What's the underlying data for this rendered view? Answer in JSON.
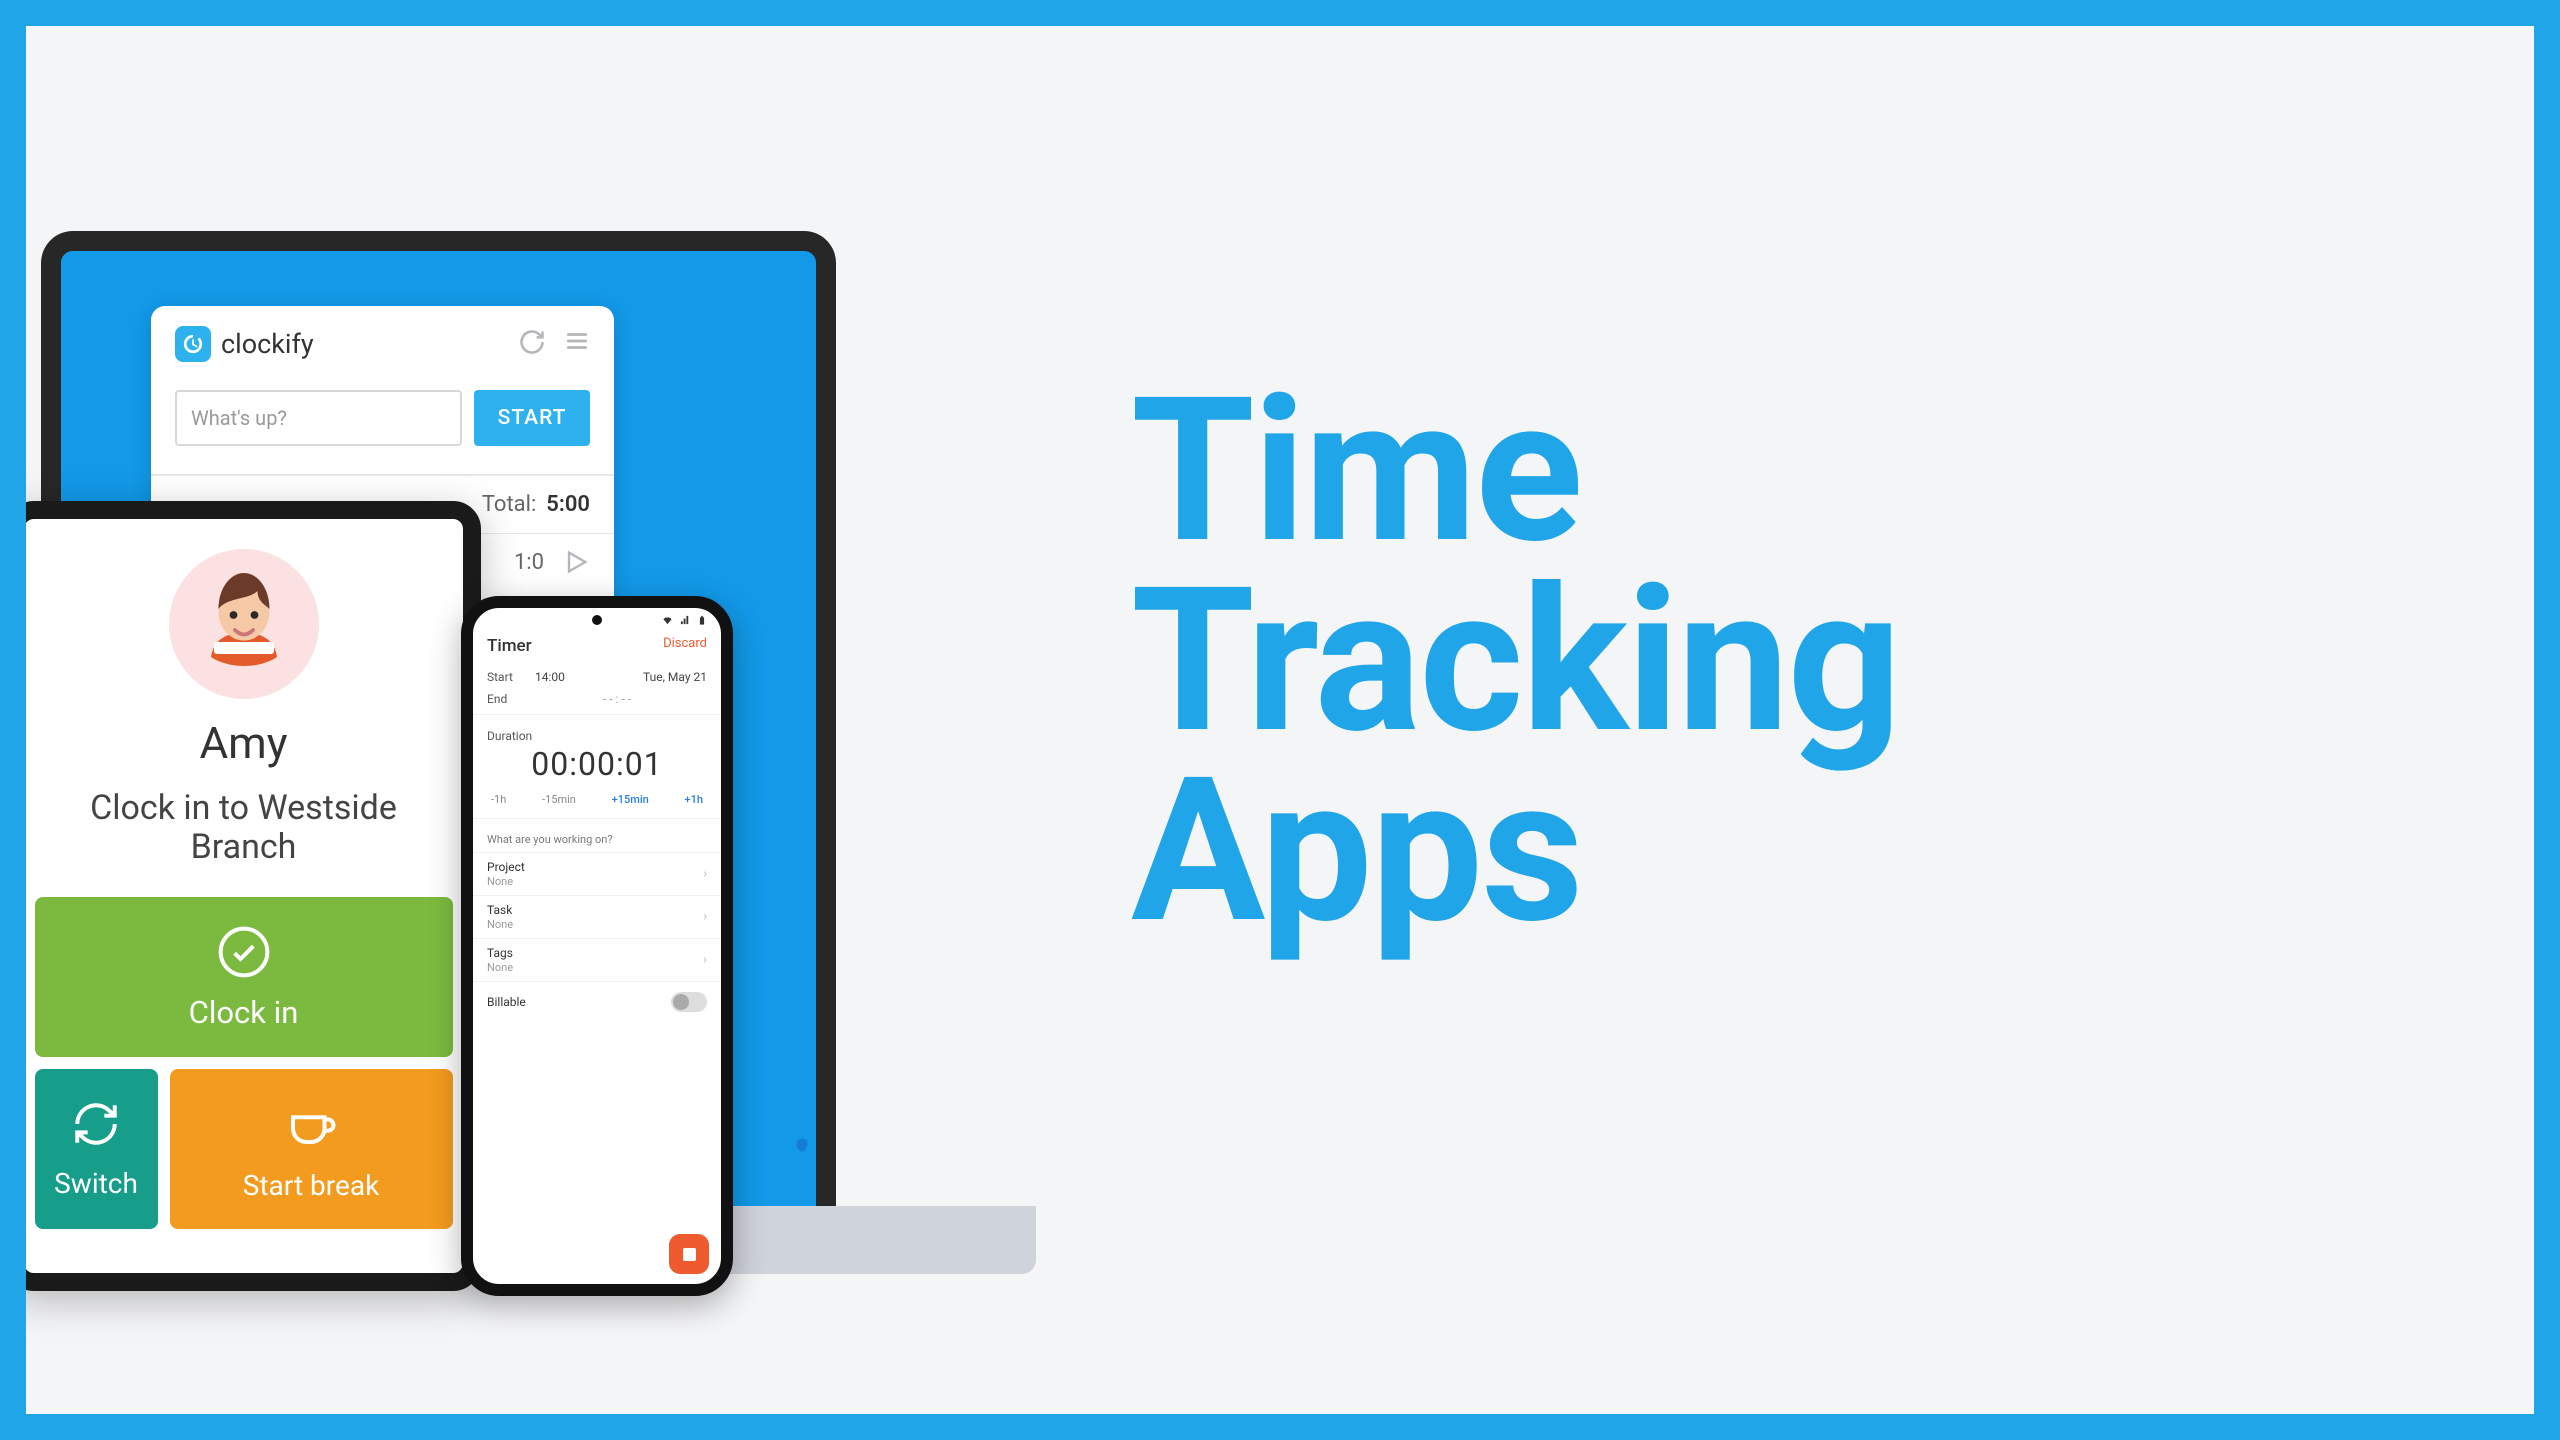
{
  "title_lines": {
    "l1": "Time",
    "l2": "Tracking",
    "l3": "Apps"
  },
  "clockify": {
    "brand": "clockify",
    "input_placeholder": "What's up?",
    "start_label": "START",
    "total_label": "Total:",
    "total_value": "5:00",
    "entry_time": "1:0"
  },
  "tablet": {
    "user_name": "Amy",
    "location_line1": "Clock in to Westside",
    "location_line2": "Branch",
    "clockin_label": "Clock in",
    "switch_label": "Switch",
    "break_label": "Start break"
  },
  "phone": {
    "title": "Timer",
    "discard": "Discard",
    "start_label": "Start",
    "start_time": "14:00",
    "date": "Tue, May 21",
    "end_label": "End",
    "end_time": "- - : - -",
    "duration_label": "Duration",
    "duration_value": "00:00:01",
    "quick": {
      "m1h": "-1h",
      "m15": "-15min",
      "p15": "+15min",
      "p1h": "+1h"
    },
    "prompt": "What are you working on?",
    "project_label": "Project",
    "task_label": "Task",
    "tags_label": "Tags",
    "none": "None",
    "billable_label": "Billable"
  }
}
